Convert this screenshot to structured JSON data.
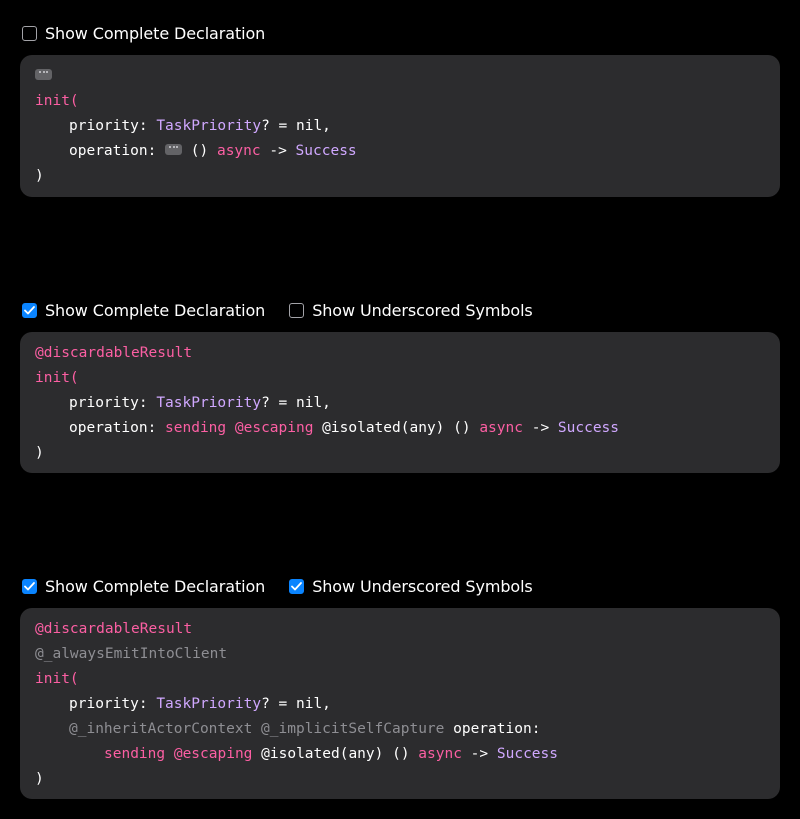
{
  "panel1": {
    "toggles": [
      {
        "label": "Show Complete Declaration",
        "checked": false
      }
    ],
    "code": {
      "ellipsis_icon": "ellipsis-icon",
      "init": "init(",
      "priority_label": "priority: ",
      "priority_type": "TaskPriority",
      "priority_default": "? = nil,",
      "operation_label": "operation: ",
      "parens": "() ",
      "async": "async",
      "arrow": " -> ",
      "success": "Success",
      "close": ")"
    }
  },
  "panel2": {
    "toggles": [
      {
        "label": "Show Complete Declaration",
        "checked": true
      },
      {
        "label": "Show Underscored Symbols",
        "checked": false
      }
    ],
    "code": {
      "attr": "@discardableResult",
      "init": "init(",
      "priority_label": "priority: ",
      "priority_type": "TaskPriority",
      "priority_default": "? = nil,",
      "operation_label": "operation: ",
      "sending": "sending",
      "escaping": "@escaping",
      "isolated": " @isolated(any) () ",
      "async": "async",
      "arrow": " -> ",
      "success": "Success",
      "close": ")"
    }
  },
  "panel3": {
    "toggles": [
      {
        "label": "Show Complete Declaration",
        "checked": true
      },
      {
        "label": "Show Underscored Symbols",
        "checked": true
      }
    ],
    "code": {
      "attr": "@discardableResult",
      "always": "@_alwaysEmitIntoClient",
      "init": "init(",
      "priority_label": "priority: ",
      "priority_type": "TaskPriority",
      "priority_default": "? = nil,",
      "inherit": "@_inheritActorContext @_implicitSelfCapture",
      "operation_label": " operation:",
      "sending": "sending",
      "escaping": "@escaping",
      "isolated": " @isolated(any) () ",
      "async": "async",
      "arrow": " -> ",
      "success": "Success",
      "close": ")"
    }
  },
  "colors": {
    "background": "#000000",
    "panel": "#2c2c2e",
    "checkbox_on": "#0a84ff",
    "keyword": "#fc5fa3",
    "type": "#d0a8ff",
    "underscored": "#8e8e93"
  }
}
